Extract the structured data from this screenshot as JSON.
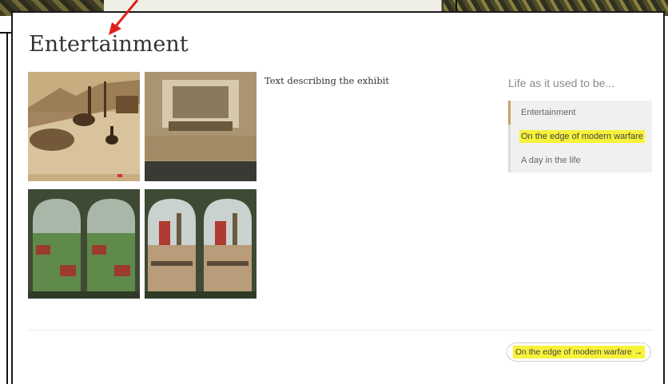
{
  "page": {
    "title": "Entertainment",
    "exhibit_text": "Text describing the exhibit"
  },
  "sidebar": {
    "heading": "Life as it used to be...",
    "items": [
      {
        "label": "Entertainment",
        "active": true,
        "highlighted": false
      },
      {
        "label": "On the edge of modern warfare",
        "active": false,
        "highlighted": true
      },
      {
        "label": "A day in the life",
        "active": false,
        "highlighted": false
      }
    ]
  },
  "gallery": {
    "images": [
      {
        "name": "parade-street-photo",
        "tone": "sepia"
      },
      {
        "name": "stage-interior-photo",
        "tone": "sepia"
      },
      {
        "name": "aerial-town-stereoview",
        "tone": "color"
      },
      {
        "name": "fair-street-stereoview",
        "tone": "color"
      }
    ]
  },
  "footer": {
    "next_label": "On the edge of modern warfare →"
  },
  "colors": {
    "highlight": "#f7f23a",
    "annotation_arrow": "#e0201b",
    "active_accent": "#c7a46a"
  }
}
